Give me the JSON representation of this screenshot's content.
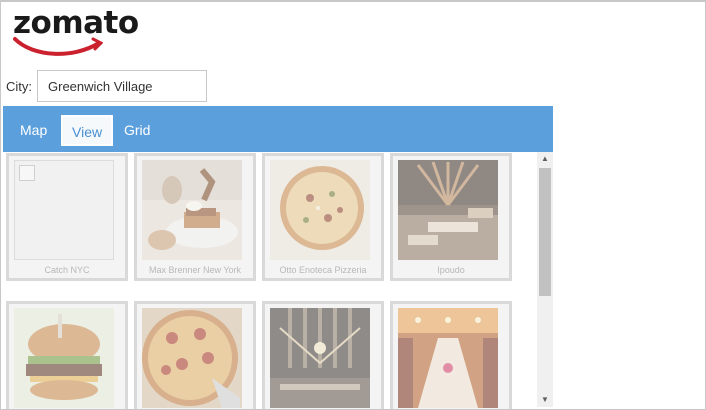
{
  "brand": {
    "name": "zomato"
  },
  "search": {
    "label": "City:",
    "value": "Greenwich Village"
  },
  "tabs": [
    {
      "label": "Map",
      "active": false
    },
    {
      "label": "View",
      "active": true
    },
    {
      "label": "Grid",
      "active": false
    }
  ],
  "restaurants": [
    {
      "name": "Catch NYC",
      "image": "none"
    },
    {
      "name": "Max Brenner New York",
      "image": "waffle-dessert-photo"
    },
    {
      "name": "Otto Enoteca Pizzeria",
      "image": "pizza-photo"
    },
    {
      "name": "Ipoudo",
      "image": "restaurant-interior-photo"
    },
    {
      "name": "",
      "image": "burger-photo"
    },
    {
      "name": "",
      "image": "pepperoni-pizza-photo"
    },
    {
      "name": "",
      "image": "venue-lights-photo"
    },
    {
      "name": "",
      "image": "banquet-hall-photo"
    }
  ],
  "colors": {
    "tabbar": "#5b9fdd",
    "brand_red": "#cb202d"
  }
}
